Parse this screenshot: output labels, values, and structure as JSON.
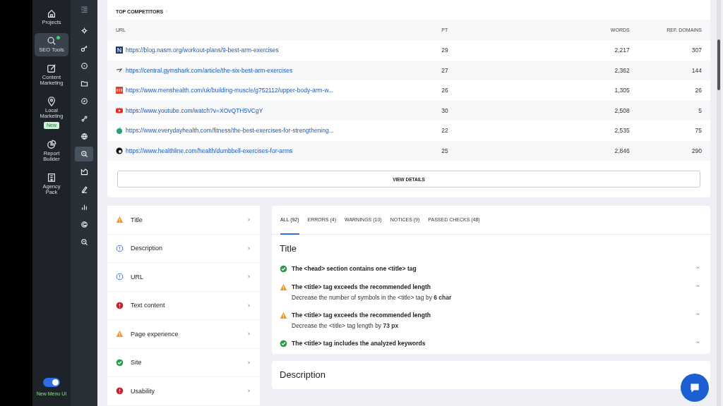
{
  "nav": {
    "items": [
      {
        "label": "Projects",
        "selected": false
      },
      {
        "label": "SEO Tools",
        "selected": true,
        "dot": true
      },
      {
        "label": "Content Marketing",
        "selected": false
      },
      {
        "label": "Local Marketing",
        "selected": false,
        "badge": "New"
      },
      {
        "label": "Report Builder",
        "selected": false
      },
      {
        "label": "Agency Pack",
        "selected": false
      }
    ],
    "toggle": {
      "label": "New Menu UI",
      "on": true
    }
  },
  "tools": [
    {
      "selected": false
    },
    {
      "selected": false
    },
    {
      "selected": false
    },
    {
      "selected": false
    },
    {
      "selected": false
    },
    {
      "selected": false
    },
    {
      "selected": false
    },
    {
      "selected": true
    },
    {
      "selected": false
    },
    {
      "selected": false
    },
    {
      "selected": false
    },
    {
      "selected": false
    },
    {
      "selected": false
    }
  ],
  "competitors": {
    "title": "TOP COMPETITORS",
    "columns": [
      "URL",
      "PT",
      "WORDS",
      "REF. DOMAINS"
    ],
    "rows": [
      {
        "url": "https://blog.nasm.org/workout-plans/9-best-arm-exercises",
        "pt": "29",
        "words": "2,217",
        "ref_domains": "307"
      },
      {
        "url": "https://central.gymshark.com/article/the-six-best-arm-exercises",
        "pt": "27",
        "words": "2,362",
        "ref_domains": "144"
      },
      {
        "url": "https://www.menshealth.com/uk/building-muscle/g752112/upper-body-arm-w...",
        "pt": "26",
        "words": "1,305",
        "ref_domains": "26"
      },
      {
        "url": "https://www.youtube.com/watch?v=XOvQTH5VCgY",
        "pt": "30",
        "words": "2,508",
        "ref_domains": "5"
      },
      {
        "url": "https://www.everydayhealth.com/fitness/the-best-exercises-for-strengthening...",
        "pt": "22",
        "words": "2,535",
        "ref_domains": "75"
      },
      {
        "url": "https://www.healthline.com/health/dumbbell-exercises-for-arms",
        "pt": "25",
        "words": "2,846",
        "ref_domains": "290"
      }
    ],
    "button": "VIEW DETAILS"
  },
  "categories": [
    {
      "label": "Title",
      "kind": "warning"
    },
    {
      "label": "Description",
      "kind": "notice"
    },
    {
      "label": "URL",
      "kind": "notice"
    },
    {
      "label": "Text content",
      "kind": "error"
    },
    {
      "label": "Page experience",
      "kind": "warning"
    },
    {
      "label": "Site",
      "kind": "passed"
    },
    {
      "label": "Usability",
      "kind": "error"
    }
  ],
  "tabs": [
    {
      "label": "ALL (92)",
      "selected": true
    },
    {
      "label": "ERRORS (4)",
      "selected": false
    },
    {
      "label": "WARNINGS (10)",
      "selected": false
    },
    {
      "label": "NOTICES (9)",
      "selected": false
    },
    {
      "label": "PASSED CHECKS (48)",
      "selected": false
    }
  ],
  "sections": [
    {
      "title": "Title",
      "checks": [
        {
          "kind": "passed",
          "text": "The <head> section contains one <title> tag"
        },
        {
          "kind": "warning",
          "text": "The <title> tag exceeds the recommended length",
          "detail": "Decrease the number of symbols in the <title> tag by **6 char**"
        },
        {
          "kind": "warning",
          "text": "The <title> tag exceeds the recommended length",
          "detail": "Decrease the <title> tag length by **73 px**"
        },
        {
          "kind": "passed",
          "text": "The <title> tag includes the analyzed keywords"
        }
      ]
    },
    {
      "title": "Description"
    }
  ]
}
